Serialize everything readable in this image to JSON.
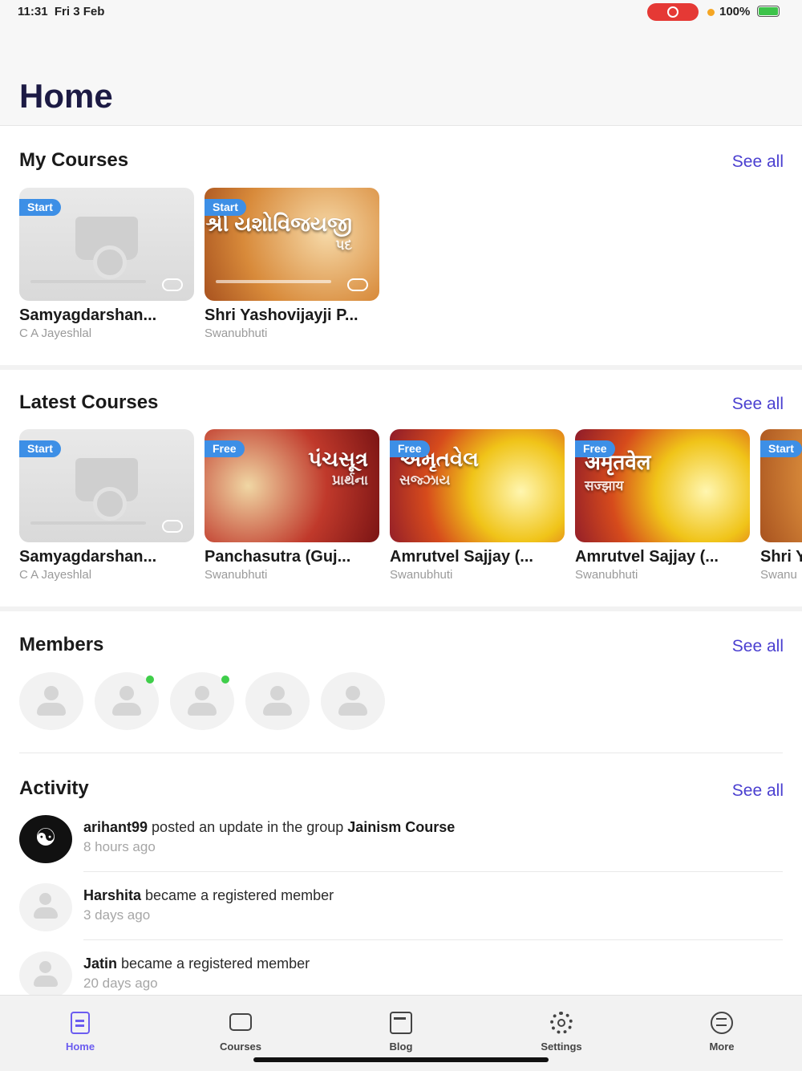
{
  "status_bar": {
    "time": "11:31",
    "date": "Fri 3 Feb",
    "battery": "100%",
    "record_color": "#e53935",
    "battery_color": "#3dc34a"
  },
  "header": {
    "title": "Home"
  },
  "my_courses": {
    "title": "My Courses",
    "see_all": "See all",
    "items": [
      {
        "badge": "Start",
        "title": "Samyagdarshan...",
        "author": "C A Jayeshlal",
        "image": "placeholder"
      },
      {
        "badge": "Start",
        "title": "Shri Yashovijayji P...",
        "author": "Swanubhuti",
        "art": "શ્રી યશોવિજયજી",
        "art_sub": "પદ"
      }
    ]
  },
  "latest_courses": {
    "title": "Latest Courses",
    "see_all": "See all",
    "items": [
      {
        "badge": "Start",
        "title": "Samyagdarshan...",
        "author": "C A Jayeshlal",
        "image": "placeholder"
      },
      {
        "badge": "Free",
        "title": "Panchasutra (Guj...",
        "author": "Swanubhuti",
        "art": "પંચસૂત્ર",
        "art_sub": "પ્રાર્થના"
      },
      {
        "badge": "Free",
        "title": "Amrutvel Sajjay (...",
        "author": "Swanubhuti",
        "art": "અમૃતવેલ",
        "art_sub": "સજ્ઝાય"
      },
      {
        "badge": "Free",
        "title": "Amrutvel Sajjay (...",
        "author": "Swanubhuti",
        "art": "अमृतवेल",
        "art_sub": "सज्झाय"
      },
      {
        "badge": "Start",
        "title": "Shri Y",
        "author": "Swanu"
      }
    ]
  },
  "members": {
    "title": "Members",
    "see_all": "See all",
    "items": [
      {
        "online": false
      },
      {
        "online": true
      },
      {
        "online": true
      },
      {
        "online": false
      },
      {
        "online": false
      }
    ]
  },
  "activity": {
    "title": "Activity",
    "see_all": "See all",
    "items": [
      {
        "user": "arihant99",
        "action": " posted an update in the group ",
        "target": "Jainism Course",
        "time": "8 hours ago",
        "avatar": "yoga"
      },
      {
        "user": "Harshita",
        "action": " became a registered member",
        "target": "",
        "time": "3 days ago",
        "avatar": "default"
      },
      {
        "user": "Jatin",
        "action": " became a registered member",
        "target": "",
        "time": "20 days ago",
        "avatar": "default"
      }
    ]
  },
  "tabbar": {
    "active_color": "#6b5cf0",
    "tabs": [
      {
        "label": "Home",
        "icon": "home-doc-icon"
      },
      {
        "label": "Courses",
        "icon": "courses-screen-icon"
      },
      {
        "label": "Blog",
        "icon": "blog-icon"
      },
      {
        "label": "Settings",
        "icon": "gear-icon"
      },
      {
        "label": "More",
        "icon": "menu-icon"
      }
    ]
  }
}
